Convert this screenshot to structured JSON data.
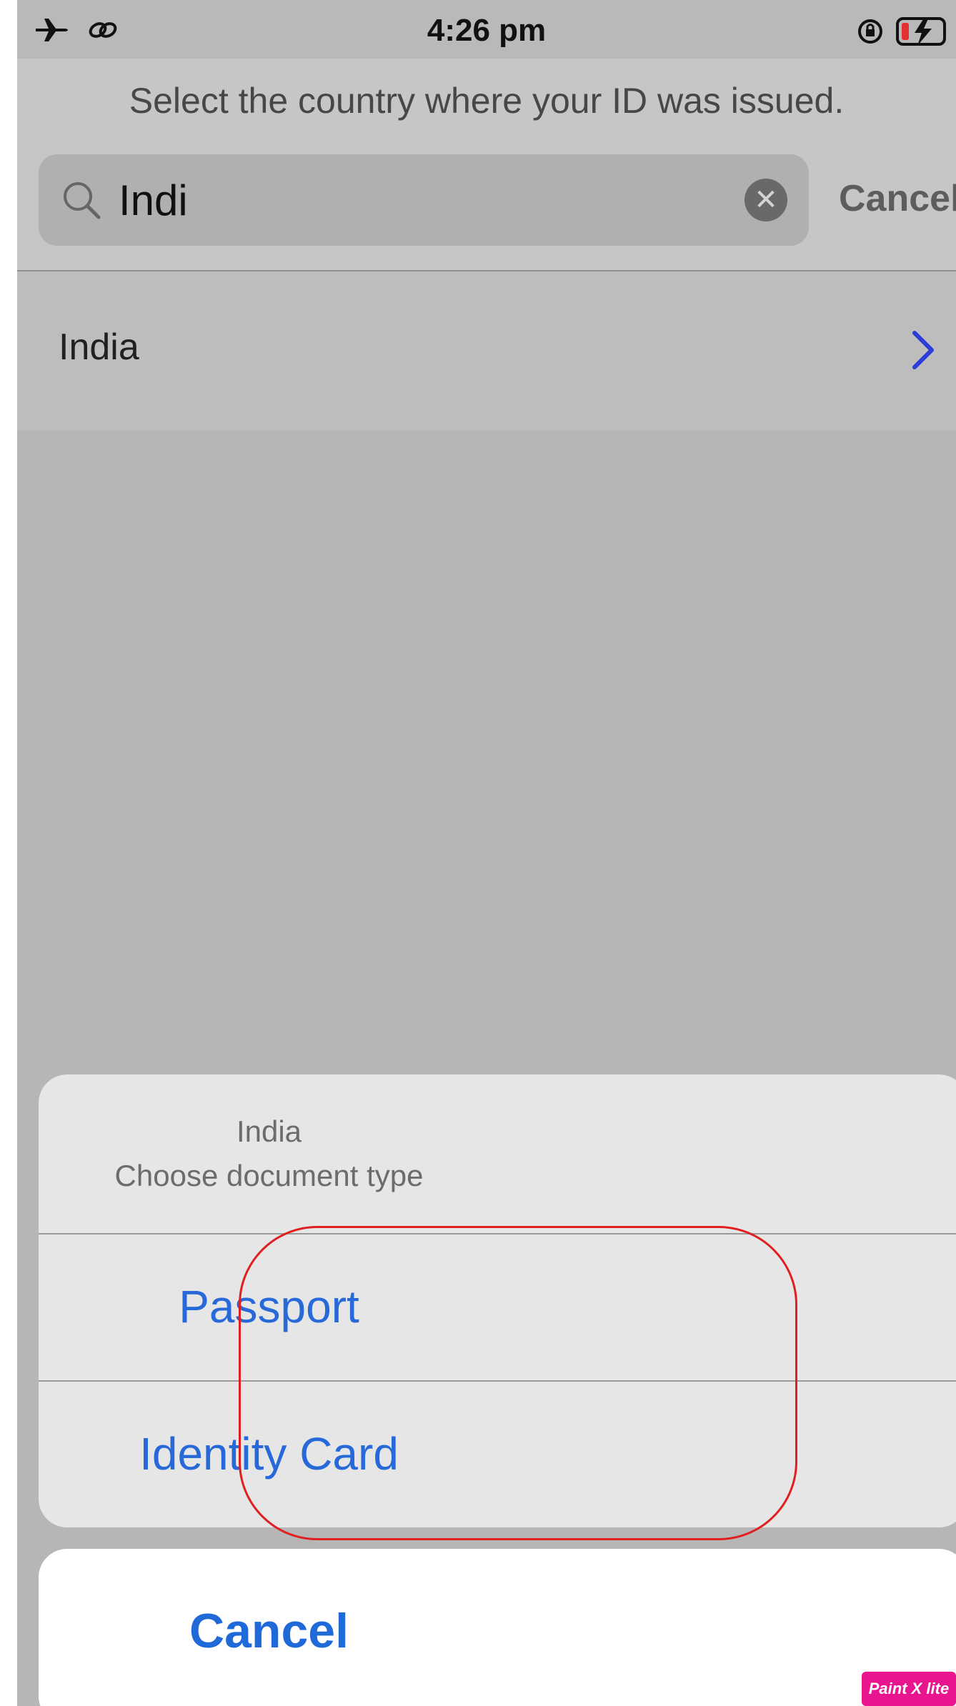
{
  "status_bar": {
    "time": "4:26 pm",
    "left_icons": [
      "airplane-icon",
      "link-icon"
    ],
    "right_icons": [
      "orientation-lock-icon",
      "battery-charging-icon"
    ]
  },
  "header": {
    "prompt": "Select the country where your ID was issued.",
    "search": {
      "value": "Indi",
      "clear_icon": "clear-icon",
      "cancel_label": "Cancel"
    }
  },
  "results": [
    {
      "label": "India",
      "icon": "chevron-right-icon"
    }
  ],
  "action_sheet": {
    "title": "India",
    "subtitle": "Choose document type",
    "options": [
      "Passport",
      "Identity Card"
    ],
    "cancel_label": "Cancel"
  },
  "colors": {
    "accent": "#2769d8",
    "annotation": "#e02020",
    "chevron": "#2b3fd8"
  },
  "watermark": "Paint X lite"
}
